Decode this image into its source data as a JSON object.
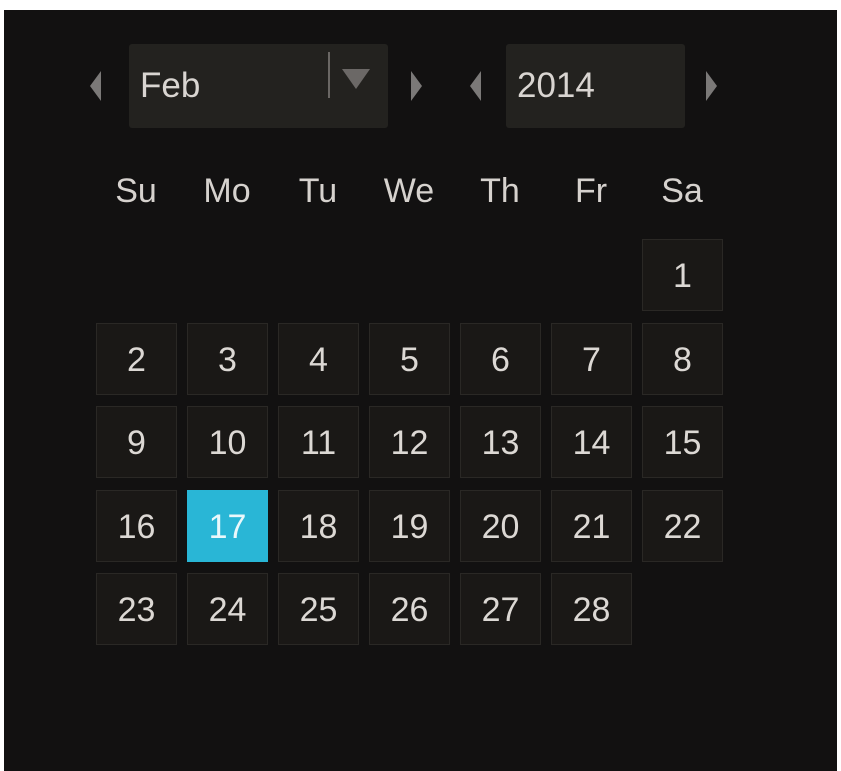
{
  "month_picker": {
    "value": "Feb"
  },
  "year_picker": {
    "value": "2014"
  },
  "weekdays": [
    "Su",
    "Mo",
    "Tu",
    "We",
    "Th",
    "Fr",
    "Sa"
  ],
  "days": [
    {
      "day": "1",
      "row": 0,
      "col": 6
    },
    {
      "day": "2",
      "row": 1,
      "col": 0
    },
    {
      "day": "3",
      "row": 1,
      "col": 1
    },
    {
      "day": "4",
      "row": 1,
      "col": 2
    },
    {
      "day": "5",
      "row": 1,
      "col": 3
    },
    {
      "day": "6",
      "row": 1,
      "col": 4
    },
    {
      "day": "7",
      "row": 1,
      "col": 5
    },
    {
      "day": "8",
      "row": 1,
      "col": 6
    },
    {
      "day": "9",
      "row": 2,
      "col": 0
    },
    {
      "day": "10",
      "row": 2,
      "col": 1
    },
    {
      "day": "11",
      "row": 2,
      "col": 2
    },
    {
      "day": "12",
      "row": 2,
      "col": 3
    },
    {
      "day": "13",
      "row": 2,
      "col": 4
    },
    {
      "day": "14",
      "row": 2,
      "col": 5
    },
    {
      "day": "15",
      "row": 2,
      "col": 6
    },
    {
      "day": "16",
      "row": 3,
      "col": 0
    },
    {
      "day": "17",
      "row": 3,
      "col": 1,
      "selected": true
    },
    {
      "day": "18",
      "row": 3,
      "col": 2
    },
    {
      "day": "19",
      "row": 3,
      "col": 3
    },
    {
      "day": "20",
      "row": 3,
      "col": 4
    },
    {
      "day": "21",
      "row": 3,
      "col": 5
    },
    {
      "day": "22",
      "row": 3,
      "col": 6
    },
    {
      "day": "23",
      "row": 4,
      "col": 0
    },
    {
      "day": "24",
      "row": 4,
      "col": 1
    },
    {
      "day": "25",
      "row": 4,
      "col": 2
    },
    {
      "day": "26",
      "row": 4,
      "col": 3
    },
    {
      "day": "27",
      "row": 4,
      "col": 4
    },
    {
      "day": "28",
      "row": 4,
      "col": 5
    }
  ],
  "colors": {
    "background": "#121111",
    "cell": "#1a1816",
    "selected": "#29b6d6",
    "text": "#dcd8d4"
  },
  "icons": {
    "prev_month": "chevron-left-icon",
    "next_month": "chevron-right-icon",
    "dropdown": "caret-down-icon",
    "prev_year": "chevron-left-icon",
    "next_year": "chevron-right-icon"
  }
}
